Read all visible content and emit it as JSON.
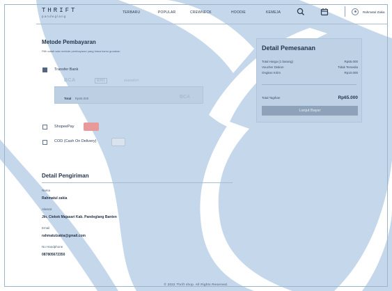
{
  "header": {
    "logo_main": "THRIFT",
    "logo_sub": "pandeglang",
    "nav": [
      "TERBARU",
      "POPULAR",
      "CREWNECK",
      "HOODIE",
      "KEMEJA"
    ],
    "icons": [
      "search-icon",
      "cart-icon"
    ],
    "user_name": "Rahmatul Zakia"
  },
  "payment": {
    "title": "Metode Pembayaran",
    "subtitle": "Pilih salah satu metode pembayaran yang biasa kamu gunakan",
    "transfer_label": "Transfer Bank",
    "banks": [
      "BCA",
      "BRI",
      "mandiri"
    ],
    "bank_total_label": "Total",
    "bank_total_value": "Rp65.000",
    "bank_selected": "BCA",
    "shopee_label": "ShopeePay",
    "cod_label": "COD (Cash On Delivery)",
    "selected_method": "Transfer Bank"
  },
  "summary": {
    "title": "Detail Pemesanan",
    "rows": [
      {
        "label": "Total Harga (1 barang)",
        "value": "Rp65.000"
      },
      {
        "label": "Voucher Diskon",
        "value": "Tidak Tersedia"
      },
      {
        "label": "Ongkos Kirim",
        "value": "Rp10.000"
      }
    ],
    "total_label": "Total Tagihan",
    "total_value": "Rp65.000",
    "pay_button": "Lanjut Bayar"
  },
  "shipping": {
    "title": "Detail Pengiriman",
    "fields": [
      {
        "label": "Nama",
        "value": "Rahmatul zakia"
      },
      {
        "label": "Alamat",
        "value": "Jln. Ciekek Majasari Kab. Pandeglang Banten"
      },
      {
        "label": "Email",
        "value": "rahmatulzakia@gmail.com"
      },
      {
        "label": "No Handphone",
        "value": "087805672350"
      }
    ]
  },
  "footer": "© 2022 Thrift shop. All Rights Reserved.",
  "colors": {
    "background": "#c5d7ea",
    "swoosh": "#ffffff",
    "accent": "#506681",
    "button": "#8ea3b9",
    "shopee": "#e89a9a"
  }
}
